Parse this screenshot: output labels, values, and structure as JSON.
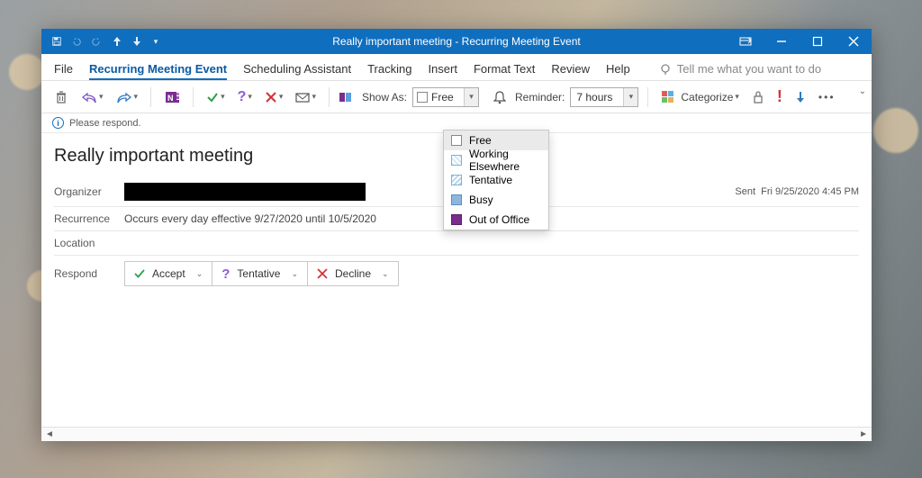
{
  "title": "Really important meeting  -  Recurring Meeting Event",
  "tabs": [
    "File",
    "Recurring Meeting Event",
    "Scheduling Assistant",
    "Tracking",
    "Insert",
    "Format Text",
    "Review",
    "Help"
  ],
  "active_tab_index": 1,
  "tell_me": "Tell me what you want to do",
  "ribbon": {
    "show_as_label": "Show As:",
    "show_as_value": "Free",
    "reminder_label": "Reminder:",
    "reminder_value": "7 hours",
    "categorize": "Categorize"
  },
  "dropdown": {
    "items": [
      "Free",
      "Working Elsewhere",
      "Tentative",
      "Busy",
      "Out of Office"
    ],
    "selected_index": 0
  },
  "infobar": "Please respond.",
  "subject": "Really important meeting",
  "fields": {
    "organizer_label": "Organizer",
    "recurrence_label": "Recurrence",
    "recurrence_value": "Occurs every day effective 9/27/2020 until 10/5/2020",
    "location_label": "Location",
    "respond_label": "Respond",
    "sent_label": "Sent",
    "sent_value": "Fri 9/25/2020 4:45 PM"
  },
  "respond": {
    "accept": "Accept",
    "tentative": "Tentative",
    "decline": "Decline"
  }
}
